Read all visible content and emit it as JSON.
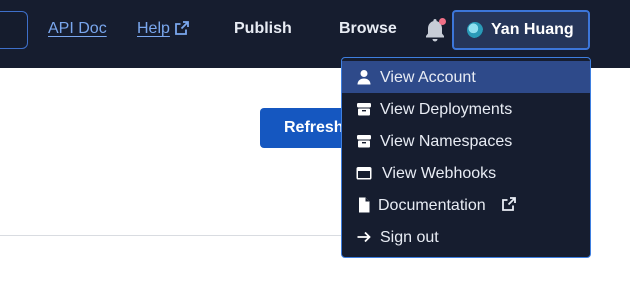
{
  "header": {
    "api_doc": "API Doc",
    "help": "Help",
    "publish": "Publish",
    "browse": "Browse",
    "notifications_icon": "bell-icon",
    "user": {
      "name": "Yan Huang",
      "avatar_icon": "avatar-globe"
    }
  },
  "main": {
    "refresh_label": "Refresh"
  },
  "user_menu": {
    "items": [
      {
        "label": "View Account",
        "icon": "user-icon",
        "active": true
      },
      {
        "label": "View Deployments",
        "icon": "box-icon"
      },
      {
        "label": "View Namespaces",
        "icon": "box-icon"
      },
      {
        "label": "View Webhooks",
        "icon": "window-icon"
      },
      {
        "label": "Documentation",
        "icon": "file-icon",
        "external": true
      },
      {
        "label": "Sign out",
        "icon": "arrow-right-icon"
      }
    ]
  },
  "colors": {
    "nav_bg": "#161d2f",
    "link": "#7aa7ee",
    "accent": "#1557c0",
    "active_item": "#2e4a8a",
    "notification_dot": "#f06f86"
  }
}
